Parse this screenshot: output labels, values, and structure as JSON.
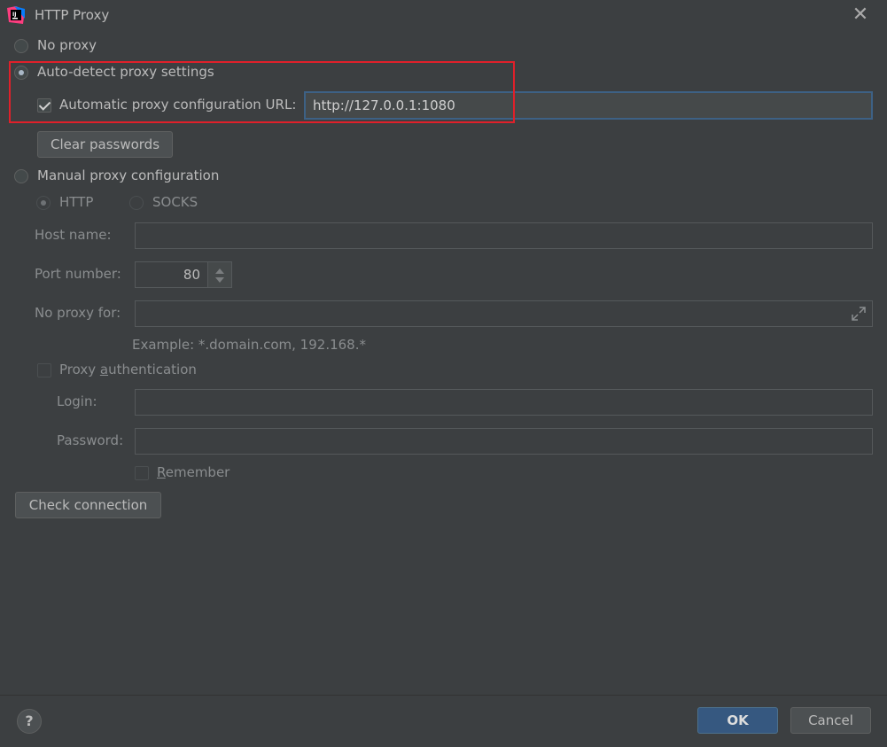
{
  "window": {
    "title": "HTTP Proxy",
    "close_icon": "close-icon",
    "app_icon": "intellij-idea-icon"
  },
  "proxy_mode": {
    "no_proxy_label": "No proxy",
    "auto_detect_label": "Auto-detect proxy settings",
    "auto_config_url_label": "Automatic proxy configuration URL:",
    "auto_config_url_value": "http://127.0.0.1:1080",
    "clear_passwords_label": "Clear passwords",
    "manual_label": "Manual proxy configuration",
    "selected": "auto-detect"
  },
  "manual": {
    "http_label": "HTTP",
    "socks_label": "SOCKS",
    "host_name_label": "Host name:",
    "host_name_value": "",
    "port_number_label": "Port number:",
    "port_number_value": "80",
    "no_proxy_for_label": "No proxy for:",
    "no_proxy_for_value": "",
    "example_text": "Example: *.domain.com, 192.168.*",
    "proxy_auth_label_pre": "Proxy ",
    "proxy_auth_label_u": "a",
    "proxy_auth_label_post": "uthentication",
    "login_label": "Login:",
    "login_value": "",
    "password_label": "Password:",
    "password_value": "",
    "remember_label_u": "R",
    "remember_label_post": "emember"
  },
  "check_connection_label": "Check connection",
  "footer": {
    "help_label": "?",
    "ok_label": "OK",
    "cancel_label": "Cancel"
  },
  "colors": {
    "background": "#3c3f41",
    "accent": "#365880",
    "highlight": "#e0202a"
  }
}
